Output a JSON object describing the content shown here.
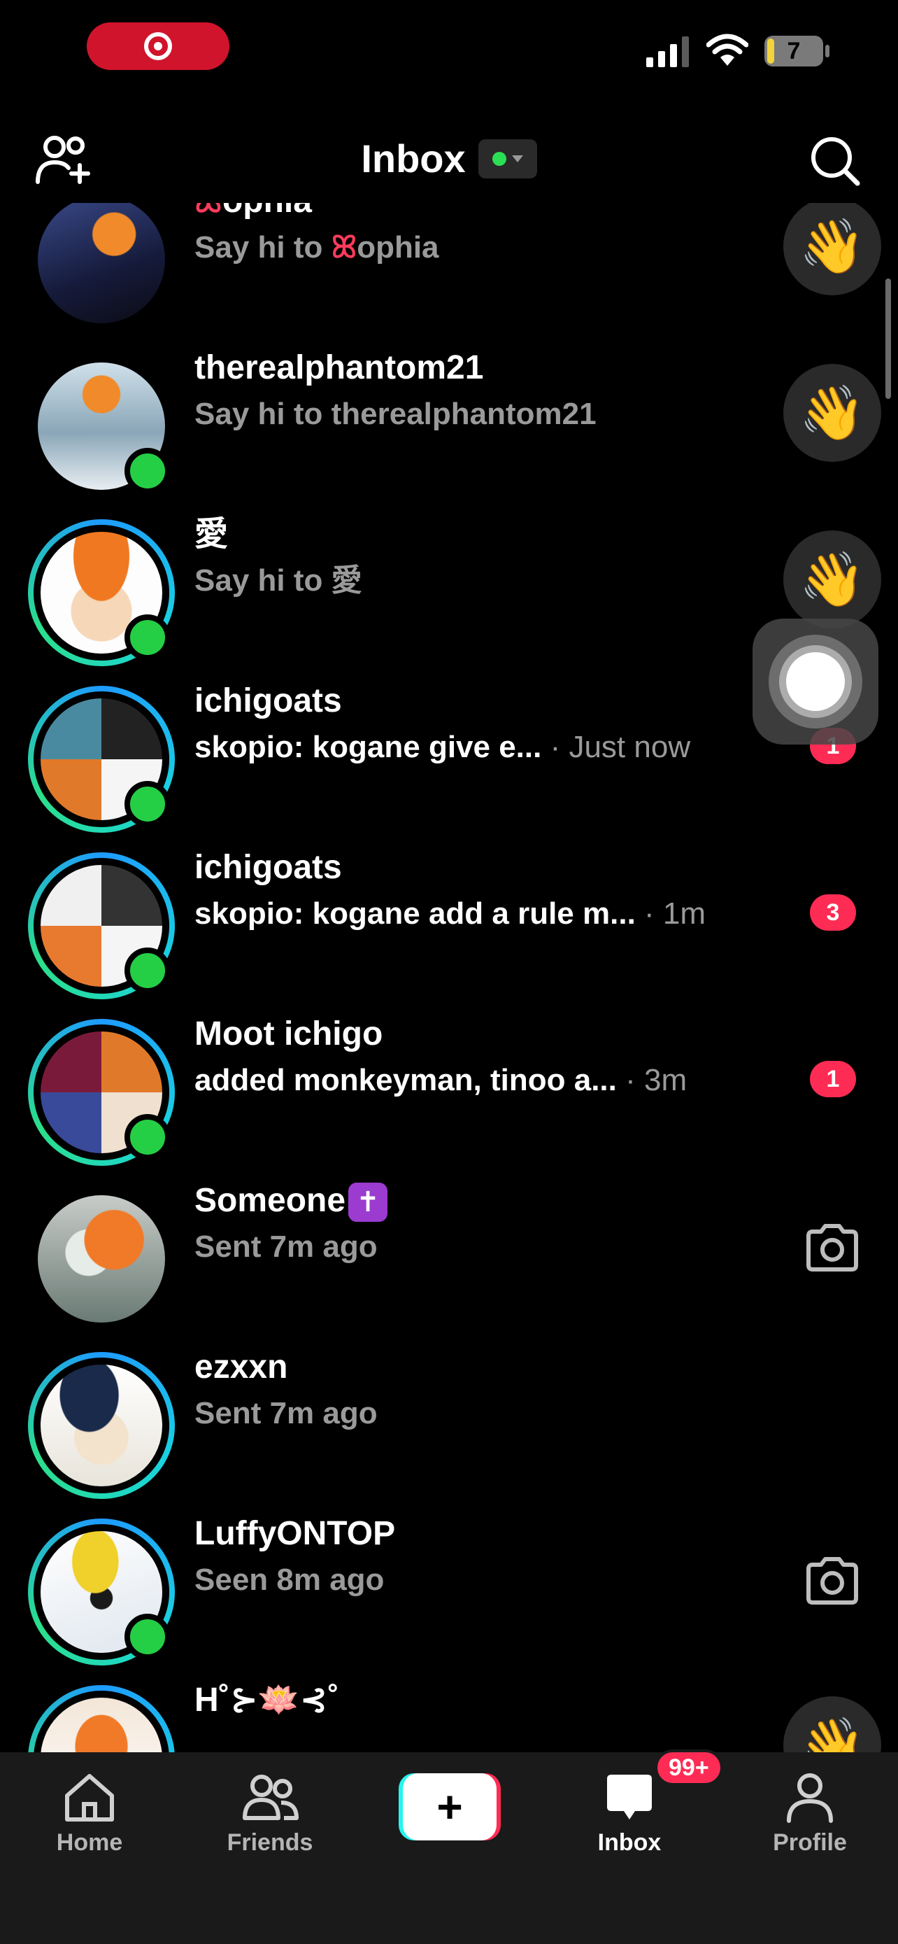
{
  "status_bar": {
    "battery_level": "7",
    "screen_recording": true
  },
  "header": {
    "title": "Inbox",
    "online_status_color": "#2bdf54"
  },
  "icons": {
    "add_friend": "add-friend-icon",
    "search": "search-icon",
    "wave": "waving-hand-icon",
    "camera": "camera-icon"
  },
  "chats": [
    {
      "name_prefix": "ꕤ",
      "name": "ophia",
      "sub": "Say hi to ",
      "sub_prefix": "ꕤ",
      "sub_name": "ophia",
      "action": "wave",
      "online": false,
      "story_ring": false
    },
    {
      "name": "therealphantom21",
      "sub": "Say hi to therealphantom21",
      "action": "wave",
      "online": true,
      "story_ring": false
    },
    {
      "name": "愛",
      "sub": "Say hi to 愛",
      "action": "wave",
      "online": true,
      "story_ring": true
    },
    {
      "name": "ichigoats",
      "sub": "skopio: kogane give e...",
      "time": " · Just now",
      "unread": "1",
      "online": true,
      "story_ring": true
    },
    {
      "name": "ichigoats",
      "sub": "skopio: kogane add a rule m...",
      "time": " · 1m",
      "unread": "3",
      "online": true,
      "story_ring": true
    },
    {
      "name": "Moot ichigo",
      "sub": " added monkeyman, tinoo a...",
      "time": " · 3m",
      "unread": "1",
      "online": true,
      "story_ring": true
    },
    {
      "name": "Someone",
      "name_badge": "✝",
      "sub": "Sent 7m ago",
      "action": "camera",
      "online": false,
      "story_ring": false
    },
    {
      "name": "ezxxn",
      "sub": "Sent 7m ago",
      "online": false,
      "story_ring": true
    },
    {
      "name": "LuffyONTOP",
      "sub": "Seen 8m ago",
      "action": "camera",
      "online": true,
      "story_ring": true
    },
    {
      "name": "H˚⊱🪷⊰˚",
      "sub": "",
      "action": "wave",
      "online": false,
      "story_ring": true
    }
  ],
  "tabbar": {
    "home": "Home",
    "friends": "Friends",
    "create": "+",
    "inbox": "Inbox",
    "inbox_badge": "99+",
    "profile": "Profile"
  },
  "colors": {
    "accent": "#fe2c55",
    "online": "#25cf45",
    "story_ring_start": "#1e9bff",
    "story_ring_end": "#2bdf8a"
  }
}
